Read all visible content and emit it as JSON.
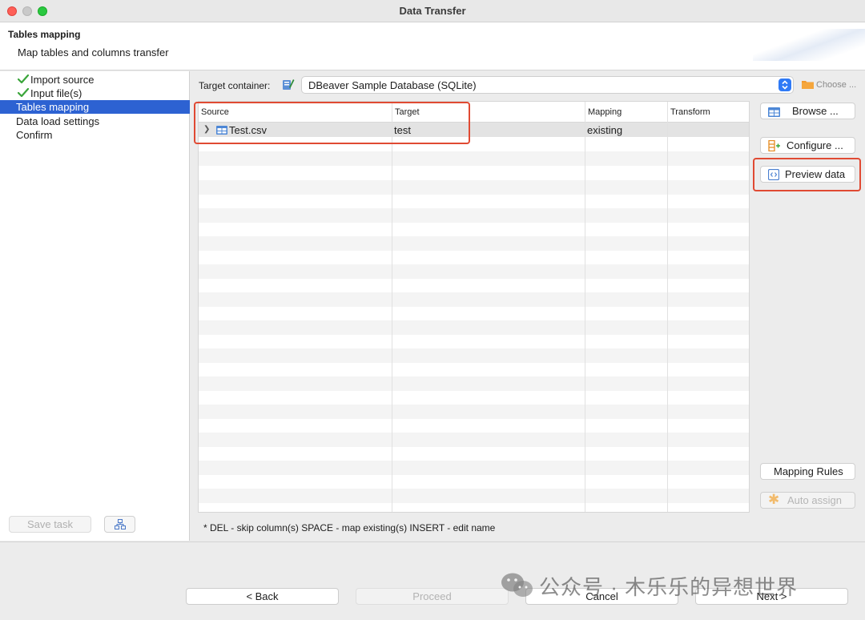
{
  "window": {
    "title": "Data Transfer"
  },
  "header": {
    "title": "Tables mapping",
    "subtitle": "Map tables and columns transfer"
  },
  "nav": {
    "items": [
      {
        "label": "Import source",
        "done": true
      },
      {
        "label": "Input file(s)",
        "done": true
      },
      {
        "label": "Tables mapping",
        "selected": true
      },
      {
        "label": "Data load settings"
      },
      {
        "label": "Confirm"
      }
    ],
    "save_task": "Save task"
  },
  "target": {
    "label": "Target container:",
    "value": "DBeaver Sample Database (SQLite)",
    "choose": "Choose ..."
  },
  "grid": {
    "columns": [
      "Source",
      "Target",
      "Mapping",
      "Transform"
    ],
    "rows": [
      {
        "source": "Test.csv",
        "target": "test",
        "mapping": "existing",
        "transform": ""
      }
    ]
  },
  "side_buttons": {
    "browse": "Browse ...",
    "configure": "Configure ...",
    "preview": "Preview data",
    "mapping_rules": "Mapping Rules",
    "auto_assign": "Auto assign"
  },
  "hint": "* DEL - skip column(s)  SPACE - map existing(s)  INSERT - edit name",
  "footer": {
    "back": "< Back",
    "proceed": "Proceed",
    "cancel": "Cancel",
    "next": "Next >"
  },
  "watermark": "公众号 · 木乐乐的异想世界",
  "colors": {
    "selection": "#2d62d2",
    "highlight": "#e04a33",
    "check": "#3aa53a"
  }
}
